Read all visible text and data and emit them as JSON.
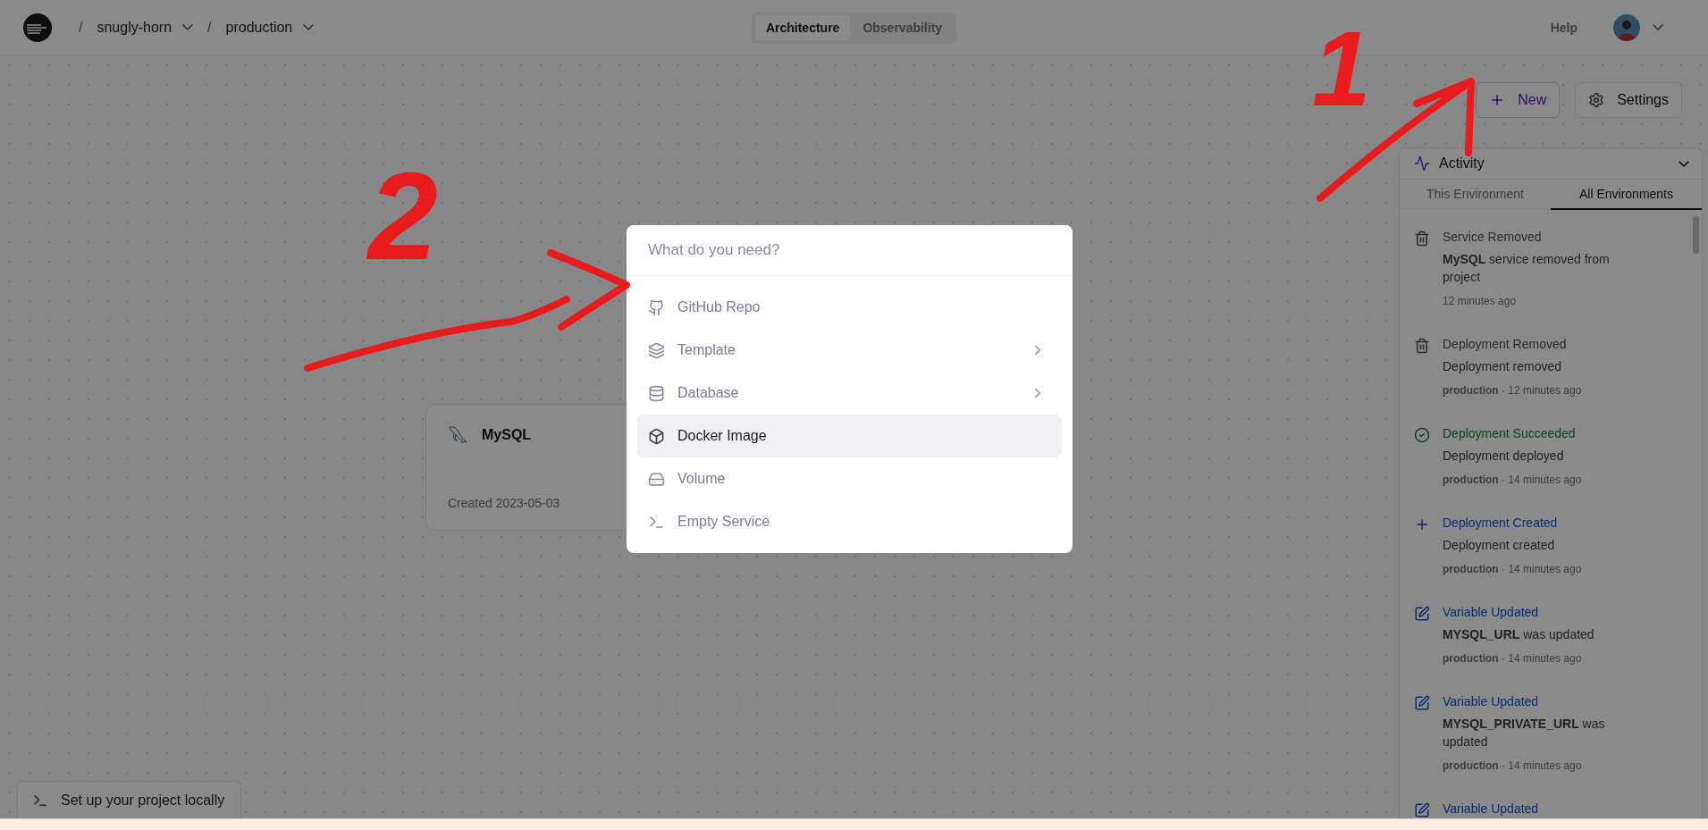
{
  "topbar": {
    "breadcrumbs": [
      {
        "separator": "/",
        "label": "snugly-horn"
      },
      {
        "separator": "/",
        "label": "production"
      }
    ],
    "view_tabs": [
      {
        "label": "Architecture",
        "selected": true
      },
      {
        "label": "Observability",
        "selected": false
      }
    ],
    "help": "Help"
  },
  "toolbar": {
    "new_button": "New",
    "settings_button": "Settings"
  },
  "canvas": {
    "service_card": {
      "name": "MySQL",
      "created": "Created 2023-05-03"
    },
    "setup_button": "Set up your project locally"
  },
  "activity": {
    "title": "Activity",
    "tabs": [
      {
        "label": "This Environment",
        "selected": false
      },
      {
        "label": "All Environments",
        "selected": true
      }
    ],
    "items": [
      {
        "kind": "removed",
        "title": "Service Removed",
        "description": "**MySQL** service removed from project",
        "meta": "12 minutes ago"
      },
      {
        "kind": "removed",
        "title": "Deployment Removed",
        "description": "Deployment removed",
        "meta": "**production** · 12 minutes ago"
      },
      {
        "kind": "succeeded",
        "title": "Deployment Succeeded",
        "description": "Deployment deployed",
        "meta": "**production** · 14 minutes ago"
      },
      {
        "kind": "created",
        "title": "Deployment Created",
        "description": "Deployment created",
        "meta": "**production** · 14 minutes ago"
      },
      {
        "kind": "updated",
        "title": "Variable Updated",
        "description": "**MYSQL_URL** was updated",
        "meta": "**production** · 14 minutes ago"
      },
      {
        "kind": "updated",
        "title": "Variable Updated",
        "description": "**MYSQL_PRIVATE_URL** was updated",
        "meta": "**production** · 14 minutes ago"
      },
      {
        "kind": "updated",
        "title": "Variable Updated"
      }
    ]
  },
  "command_menu": {
    "placeholder": "What do you need?",
    "items": [
      {
        "label": "GitHub Repo",
        "has_submenu": false,
        "selected": false
      },
      {
        "label": "Template",
        "has_submenu": true,
        "selected": false
      },
      {
        "label": "Database",
        "has_submenu": true,
        "selected": false
      },
      {
        "label": "Docker Image",
        "has_submenu": false,
        "selected": true
      },
      {
        "label": "Volume",
        "has_submenu": false,
        "selected": false
      },
      {
        "label": "Empty Service",
        "has_submenu": false,
        "selected": false
      }
    ]
  },
  "annotations": [
    {
      "label": "1"
    },
    {
      "label": "2"
    }
  ]
}
